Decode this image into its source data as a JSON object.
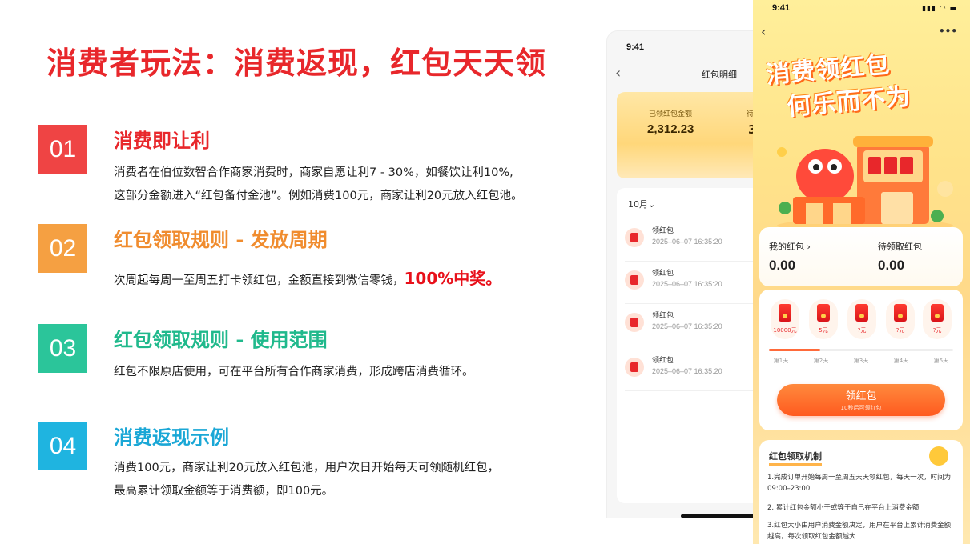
{
  "slide": {
    "title": "消费者玩法：消费返现，红包天天领",
    "items": [
      {
        "num": "01",
        "title": "消费即让利",
        "color": "#ef4444",
        "title_color": "#e8272b",
        "lines": [
          "消费者在伯位数智合作商家消费时，商家自愿让利7 - 30%，如餐饮让利10%,",
          "这部分金额进入“红包备付金池”。例如消费100元，商家让利20元放入红包池。"
        ]
      },
      {
        "num": "02",
        "title": "红包领取规则 - 发放周期",
        "color": "#f5a042",
        "title_color": "#f08c2e",
        "line": "次周起每周一至周五打卡领红包，金额直接到微信零钱，",
        "highlight": "100%中奖。"
      },
      {
        "num": "03",
        "title": "红包领取规则 - 使用范围",
        "color": "#2bc59a",
        "title_color": "#20b98c",
        "lines": [
          "红包不限原店使用，可在平台所有合作商家消费，形成跨店消费循环。"
        ]
      },
      {
        "num": "04",
        "title": "消费返现示例",
        "color": "#1fb4e0",
        "title_color": "#1aa7d6",
        "lines": [
          "消费100元，商家让利20元放入红包池，用户次日开始每天可领随机红包，",
          "最高累计领取金额等于消费额，即100元。"
        ]
      }
    ]
  },
  "phone1": {
    "time": "9:41",
    "back": "‹",
    "title": "红包明细",
    "received_label": "已领红包金额",
    "received_value": "2,312.23",
    "pending_label": "待",
    "pending_value": "3",
    "month": "10月⌄",
    "records": [
      {
        "label": "领红包",
        "date": "2025–06–07 16:35:20"
      },
      {
        "label": "领红包",
        "date": "2025–06–07 16:35:20"
      },
      {
        "label": "领红包",
        "date": "2025–06–07 16:35:20"
      },
      {
        "label": "领红包",
        "date": "2025–06–07 16:35:20"
      }
    ]
  },
  "phone2": {
    "time": "9:41",
    "status": "▮▮▮ ◠ ▬",
    "back": "‹",
    "more": "•••",
    "banner_line1": "消费领红包",
    "banner_line2": "何乐而不为",
    "my_wallet_label": "我的红包 ›",
    "my_wallet_value": "0.00",
    "pending_label": "待领取红包",
    "pending_value": "0.00",
    "envelopes": [
      "10000元",
      "5元",
      "?元",
      "?元",
      "?元"
    ],
    "days": [
      "第1天",
      "第2天",
      "第3天",
      "第4天",
      "第5天"
    ],
    "progress": 0.28,
    "button_label": "领红包",
    "button_sub": "10秒后可领红包",
    "rules_title": "红包领取机制",
    "rules": [
      "1.完成订单开始每周一至周五天天领红包，每天一次，时间为09:00–23:00",
      "2..累计红包金额小于或等于自己在平台上消费金额",
      "3.红包大小由用户消费金额决定，用户在平台上累计消费金额越高，每次领取红包金额越大"
    ]
  }
}
